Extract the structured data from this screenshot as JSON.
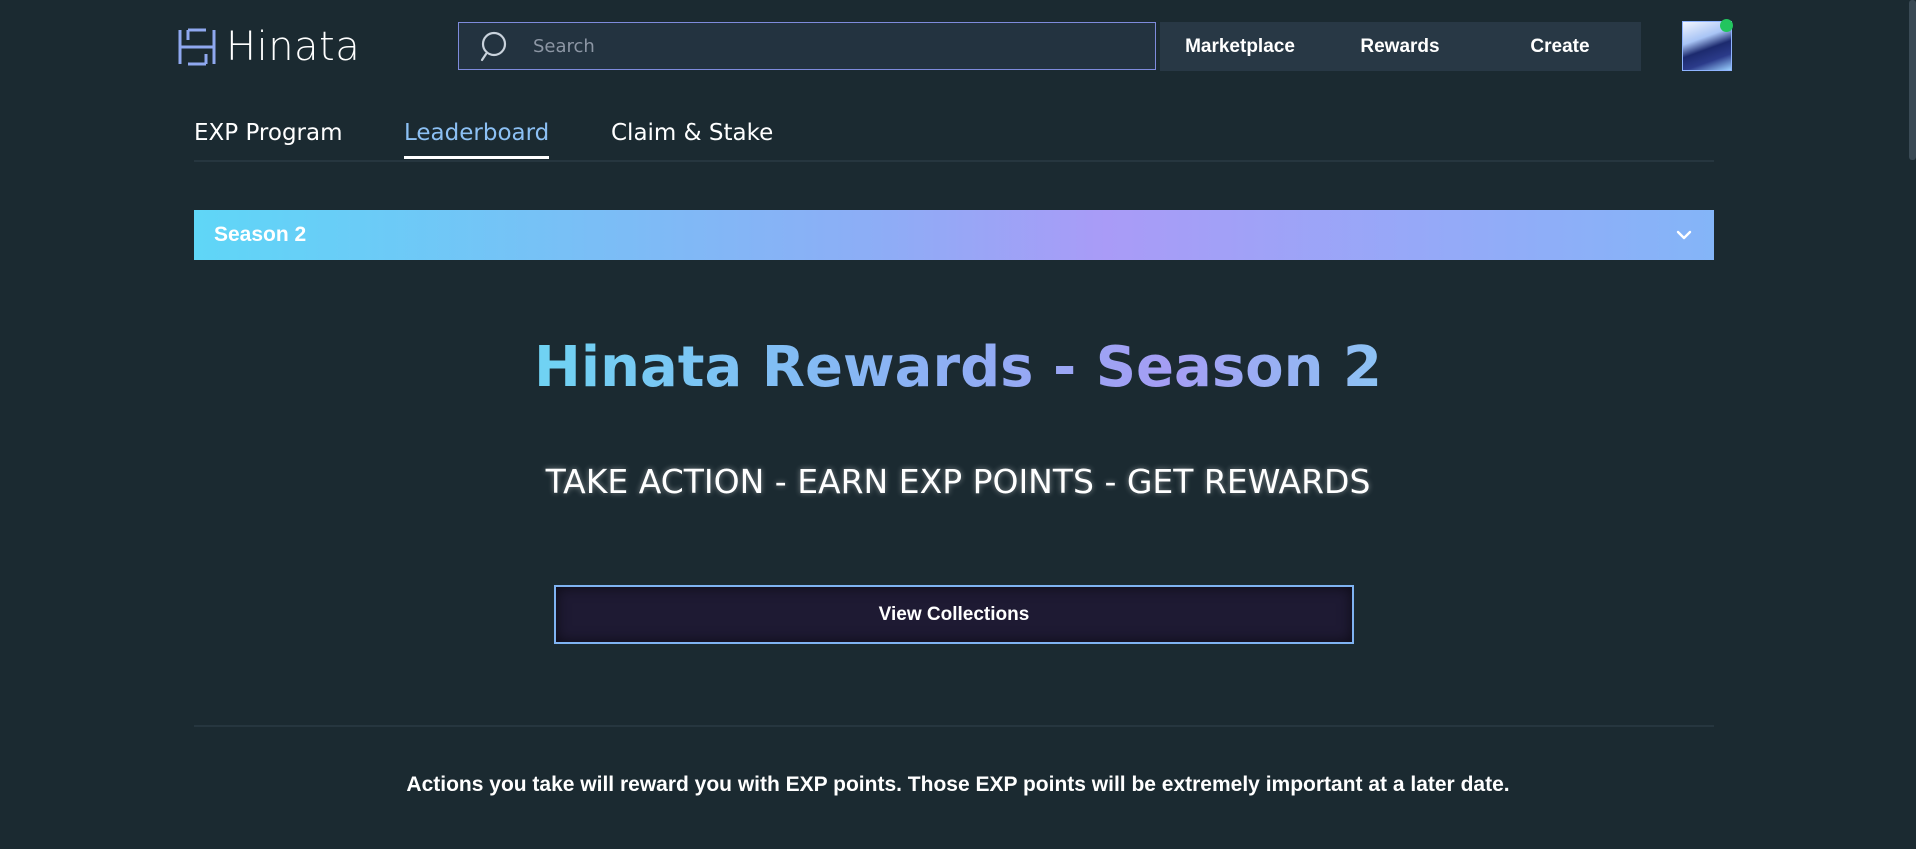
{
  "header": {
    "logo_text": "Hinata",
    "search": {
      "placeholder": "Search",
      "value": ""
    },
    "nav": {
      "marketplace": "Marketplace",
      "rewards": "Rewards",
      "create": "Create"
    }
  },
  "tabs": [
    {
      "label": "EXP Program",
      "active": false
    },
    {
      "label": "Leaderboard",
      "active": true
    },
    {
      "label": "Claim & Stake",
      "active": false
    }
  ],
  "season_dropdown": {
    "label": "Season 2"
  },
  "hero": {
    "title": "Hinata Rewards - Season 2",
    "subtitle": "TAKE ACTION - EARN EXP POINTS - GET REWARDS",
    "button_label": "View Collections"
  },
  "description": "Actions you take will reward you with EXP points. Those EXP points will be extremely important at a later date.",
  "colors": {
    "background": "#1b2a31",
    "accent_blue": "#8cc0f4",
    "accent_purple": "#a59df4",
    "online_status": "#22c55e"
  },
  "icons": {
    "search": "search-icon",
    "chevron": "chevron-down-icon",
    "logo": "hinata-logo-icon"
  }
}
